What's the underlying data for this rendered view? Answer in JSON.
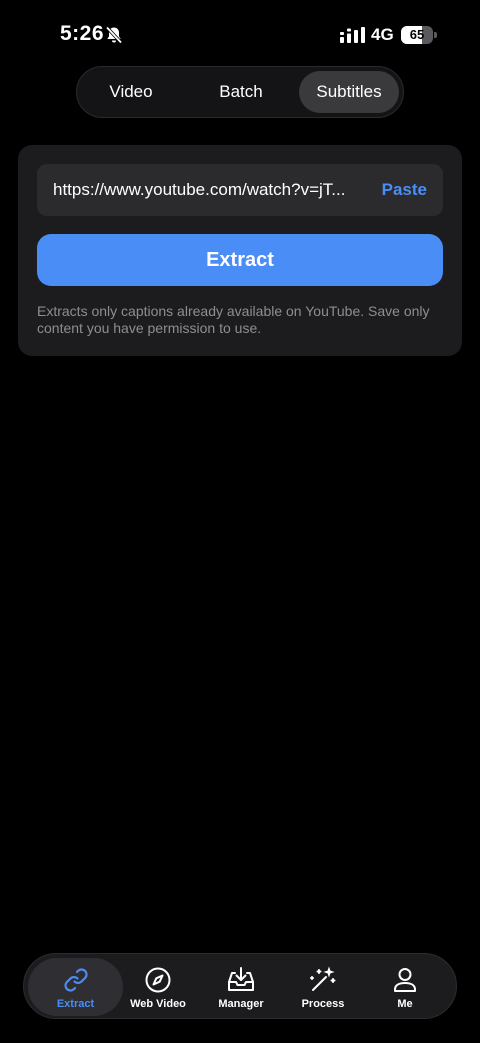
{
  "status_bar": {
    "time": "5:26",
    "network": "4G",
    "battery_percent": "65",
    "battery_level": 0.65
  },
  "segments": {
    "items": [
      "Video",
      "Batch",
      "Subtitles"
    ],
    "selected": "Subtitles"
  },
  "extract_card": {
    "url_value": "https://www.youtube.com/watch?v=jT...",
    "paste_label": "Paste",
    "extract_label": "Extract",
    "disclaimer": "Extracts only captions already available on YouTube. Save only content you have permission to use."
  },
  "tab_bar": {
    "items": [
      {
        "label": "Extract",
        "icon": "link-icon",
        "active": true
      },
      {
        "label": "Web Video",
        "icon": "compass-icon",
        "active": false
      },
      {
        "label": "Manager",
        "icon": "download-tray-icon",
        "active": false
      },
      {
        "label": "Process",
        "icon": "magic-wand-icon",
        "active": false
      },
      {
        "label": "Me",
        "icon": "person-icon",
        "active": false
      }
    ]
  },
  "colors": {
    "accent": "#4a8df6",
    "background": "#000000",
    "card": "#1c1c1e",
    "field": "#2b2b2e",
    "muted_text": "#8d8d93"
  }
}
